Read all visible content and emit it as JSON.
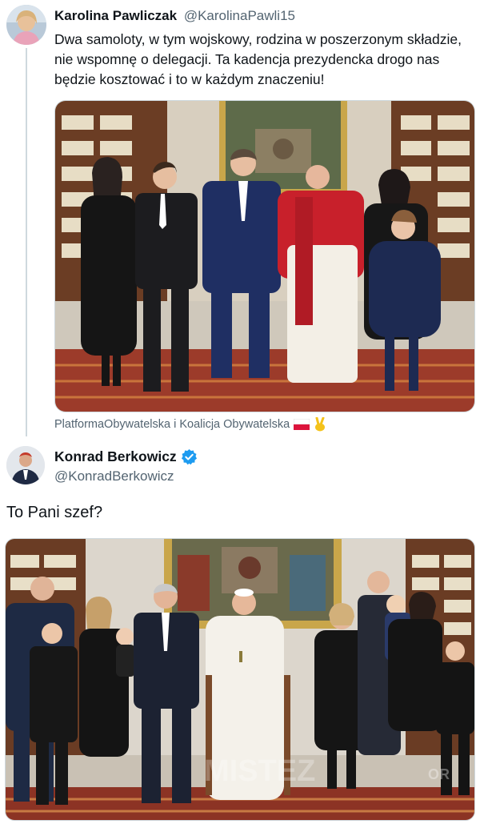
{
  "quoted_tweet": {
    "display_name": "Karolina Pawliczak",
    "handle": "@KarolinaPawli15",
    "text": "Dwa samoloty, w tym wojskowy, rodzina w poszerzonym składzie, nie wspomnę o delegacji. Ta kadencja prezydencka drogo nas będzie kosztować i to w każdym znaczeniu!",
    "source_label": "PlatformaObywatelska i Koalicja Obywatelska",
    "source_emojis": [
      "polish-flag-icon",
      "victory-hand-icon"
    ]
  },
  "main_tweet": {
    "display_name": "Konrad Berkowicz",
    "handle": "@KonradBerkowicz",
    "verified": true,
    "text": "To Pani szef?",
    "watermark": "MISTEZ",
    "watermark_suffix": "OR"
  },
  "colors": {
    "verified_badge": "#1d9bf0",
    "secondary_text": "#536471",
    "primary_text": "#0f1419",
    "border": "#cfd9de",
    "cardinal_red": "#c8202b"
  }
}
